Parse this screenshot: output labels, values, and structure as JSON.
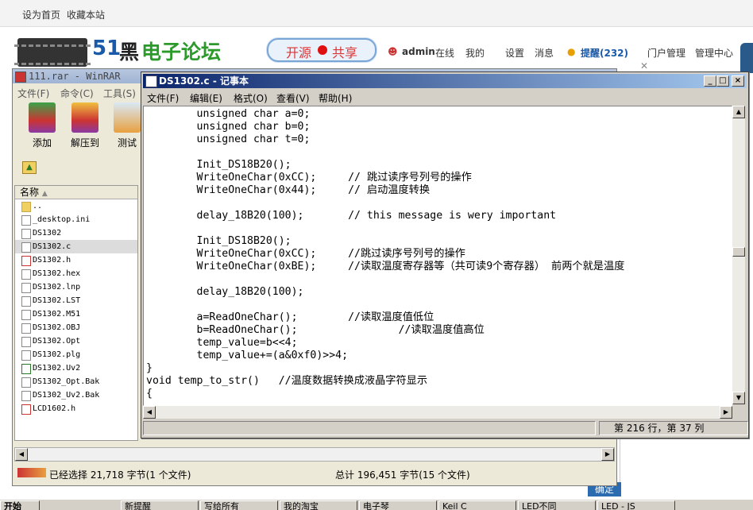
{
  "forum": {
    "topbar": {
      "set_home": "设为首页",
      "bookmark": "收藏本站"
    },
    "logo": {
      "num": "51",
      "black": "黑",
      "rest": "电子论坛"
    },
    "slogan": {
      "left": "开源",
      "right": "共享"
    },
    "nav": {
      "user": "admin",
      "online": "在线",
      "my": "我的",
      "settings": "设置",
      "messages": "消息",
      "reminder": "提醒(232)",
      "portal": "门户管理",
      "admin_center": "管理中心"
    },
    "ok_button": "确定"
  },
  "winrar": {
    "title": "111.rar - WinRAR",
    "menu": [
      "文件(F)",
      "命令(C)",
      "工具(S)"
    ],
    "tools": [
      "添加",
      "解压到",
      "测试"
    ],
    "column_name": "名称",
    "files": [
      "..",
      "_desktop.ini",
      "DS1302",
      "DS1302.c",
      "DS1302.h",
      "DS1302.hex",
      "DS1302.lnp",
      "DS1302.LST",
      "DS1302.M51",
      "DS1302.OBJ",
      "DS1302.Opt",
      "DS1302.plg",
      "DS1302.Uv2",
      "DS1302_Opt.Bak",
      "DS1302_Uv2.Bak",
      "LCD1602.h"
    ],
    "status_selected": "已经选择 21,718 字节(1 个文件)",
    "status_total": "总计 196,451 字节(15 个文件)"
  },
  "notepad": {
    "title": "DS1302.c - 记事本",
    "menu": [
      "文件(F)",
      "编辑(E)",
      "格式(O)",
      "查看(V)",
      "帮助(H)"
    ],
    "code": "        unsigned char a=0;\n        unsigned char b=0;\n        unsigned char t=0;\n\n        Init_DS18B20();\n        WriteOneChar(0xCC);     // 跳过读序号列号的操作\n        WriteOneChar(0x44);     // 启动温度转换\n\n        delay_18B20(100);       // this message is wery important\n\n        Init_DS18B20();\n        WriteOneChar(0xCC);     //跳过读序号列号的操作\n        WriteOneChar(0xBE);     //读取温度寄存器等（共可读9个寄存器） 前两个就是温度\n\n        delay_18B20(100);\n\n        a=ReadOneChar();        //读取温度值低位\n        b=ReadOneChar();                //读取温度值高位\n        temp_value=b<<4;\n        temp_value+=(a&0xf0)>>4;\n}\nvoid temp_to_str()   //温度数据转换成液晶字符显示\n{",
    "status_position": "第 216 行，第 37 列"
  },
  "taskbar": {
    "start": "开始",
    "items": [
      "新提醒",
      "写给所有",
      "我的淘宝",
      "电子琴",
      "Keil C",
      "LED不同",
      "LED - JS"
    ]
  }
}
